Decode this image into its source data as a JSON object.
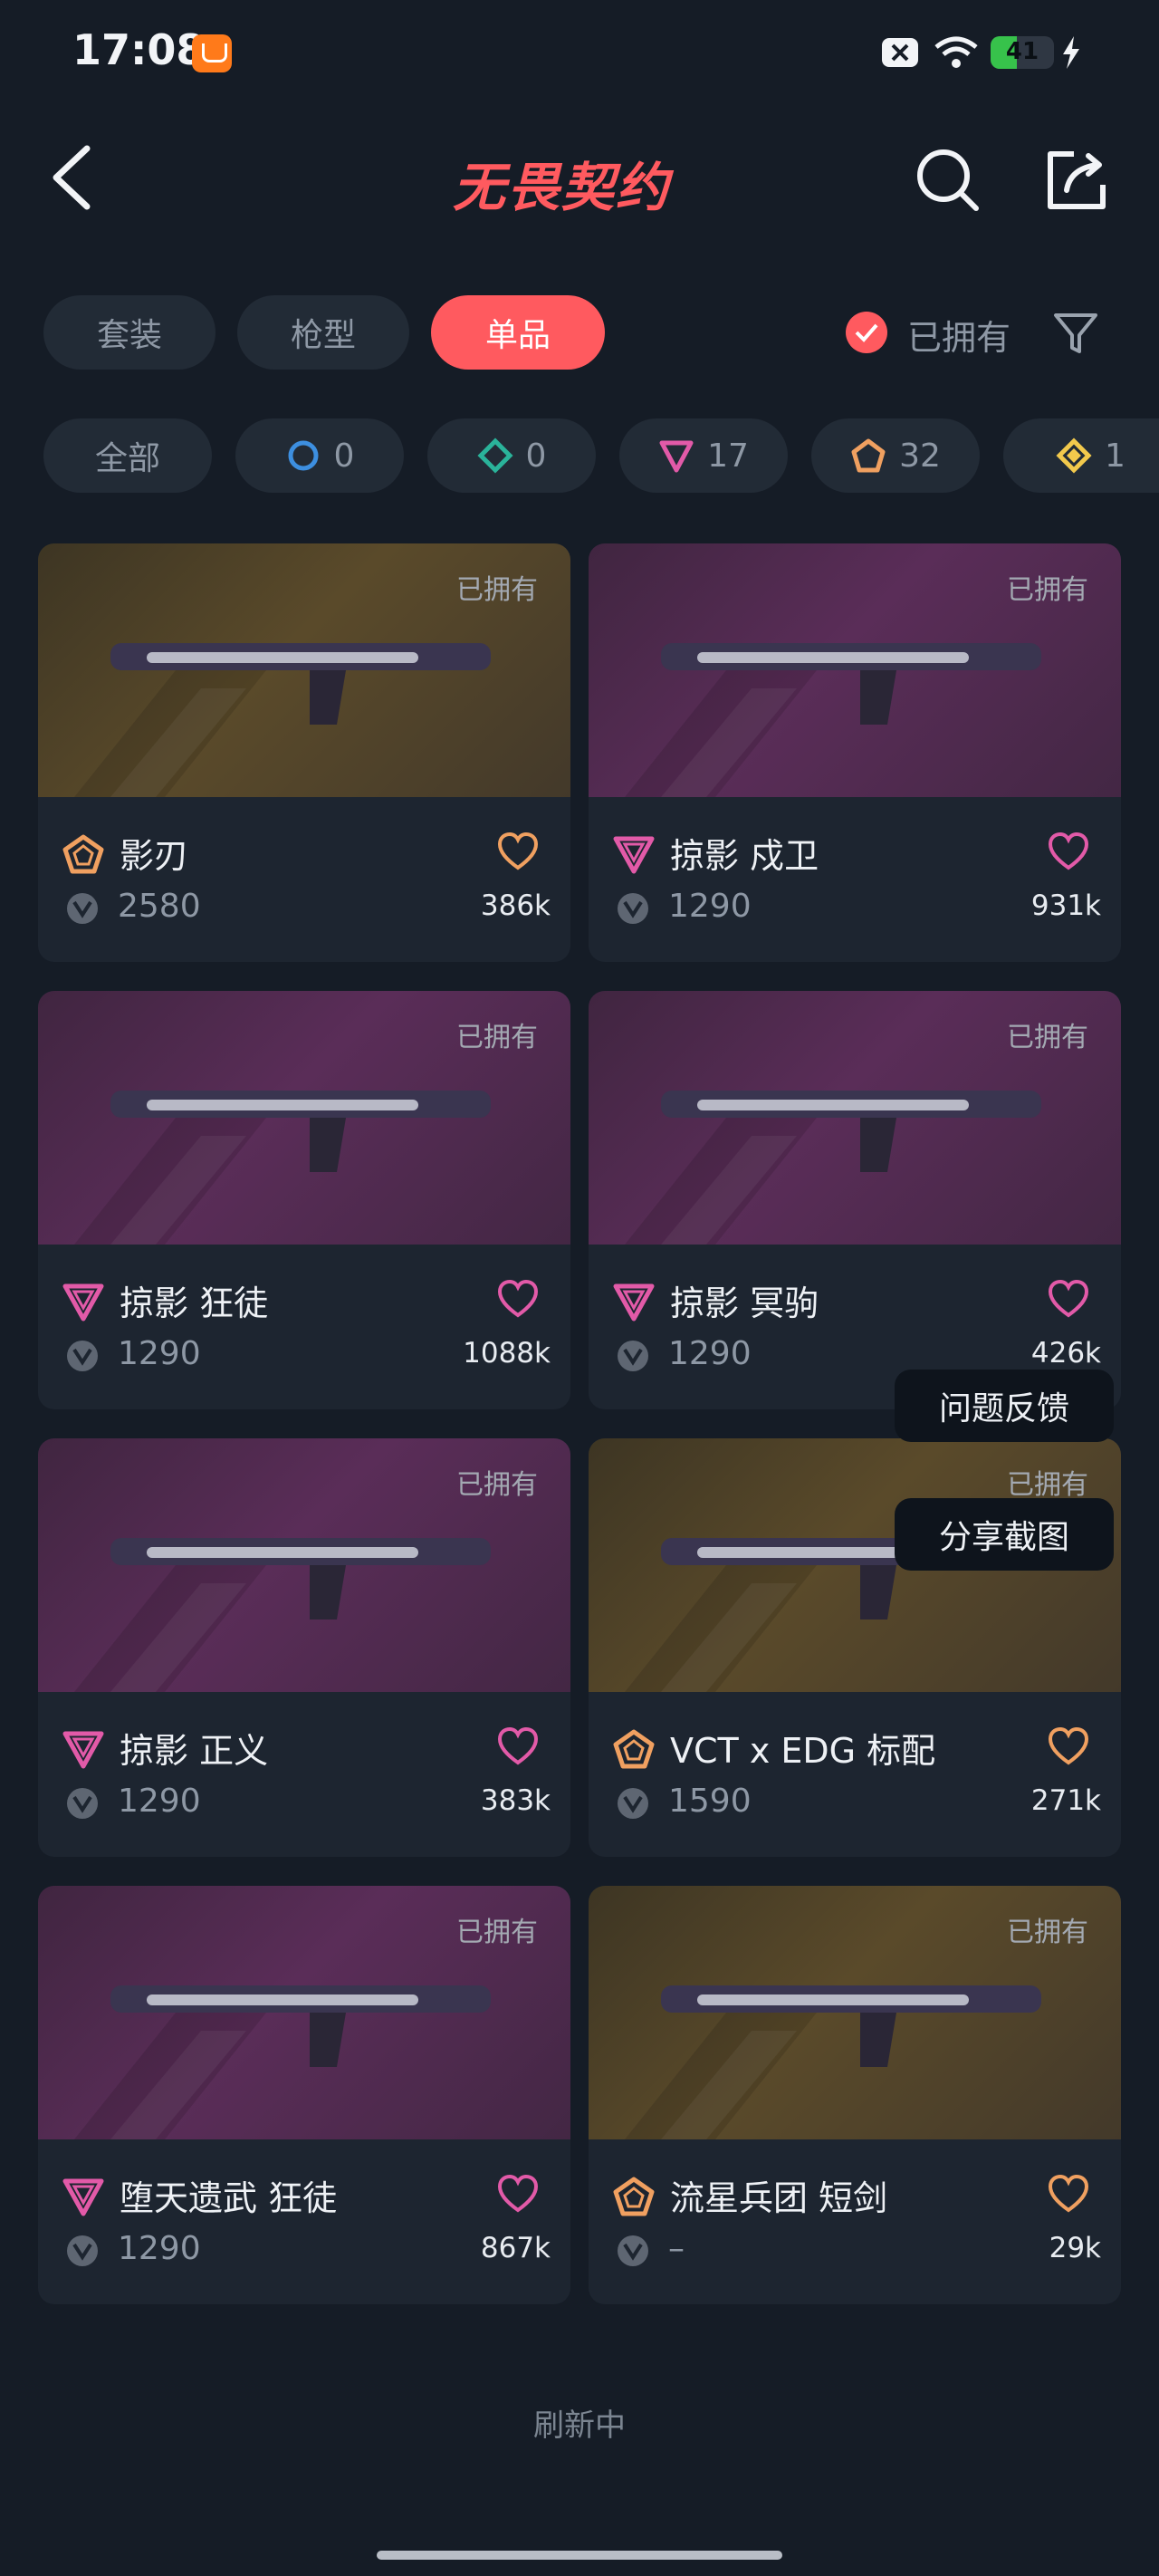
{
  "status_bar": {
    "time": "17:08",
    "battery": "41"
  },
  "header": {
    "title": "无畏契约"
  },
  "tabs": [
    {
      "label": "套装",
      "active": false
    },
    {
      "label": "枪型",
      "active": false
    },
    {
      "label": "单品",
      "active": true
    }
  ],
  "owned_filter": {
    "label": "已拥有",
    "checked": true
  },
  "rarity_chips": [
    {
      "label": "全部",
      "icon": "",
      "count": ""
    },
    {
      "label": "",
      "icon": "select-tier-icon",
      "count": "0"
    },
    {
      "label": "",
      "icon": "deluxe-tier-icon",
      "count": "0"
    },
    {
      "label": "",
      "icon": "premium-tier-icon",
      "count": "17"
    },
    {
      "label": "",
      "icon": "exclusive-tier-icon",
      "count": "32"
    },
    {
      "label": "",
      "icon": "ultra-tier-icon",
      "count": "1"
    }
  ],
  "colors": {
    "accent": "#ff5a5f",
    "exclusive": "#f0a060",
    "premium": "#e25aa8",
    "ultra": "#f2c94c"
  },
  "items": [
    {
      "owned": "已拥有",
      "name": "影刃",
      "rarity": "exclusive",
      "price": "2580",
      "likes": "386k",
      "bg": "gold"
    },
    {
      "owned": "已拥有",
      "name": "掠影 戍卫",
      "rarity": "premium",
      "price": "1290",
      "likes": "931k",
      "bg": "purple"
    },
    {
      "owned": "已拥有",
      "name": "掠影 狂徒",
      "rarity": "premium",
      "price": "1290",
      "likes": "1088k",
      "bg": "purple"
    },
    {
      "owned": "已拥有",
      "name": "掠影 冥驹",
      "rarity": "premium",
      "price": "1290",
      "likes": "426k",
      "bg": "purple"
    },
    {
      "owned": "已拥有",
      "name": "掠影 正义",
      "rarity": "premium",
      "price": "1290",
      "likes": "383k",
      "bg": "purple"
    },
    {
      "owned": "已拥有",
      "name": "VCT x EDG 标配",
      "rarity": "exclusive",
      "price": "1590",
      "likes": "271k",
      "bg": "gold"
    },
    {
      "owned": "已拥有",
      "name": "堕天遗武 狂徒",
      "rarity": "premium",
      "price": "1290",
      "likes": "867k",
      "bg": "purple"
    },
    {
      "owned": "已拥有",
      "name": "流星兵团 短剑",
      "rarity": "exclusive",
      "price": "–",
      "likes": "29k",
      "bg": "gold"
    }
  ],
  "floating": {
    "feedback": "问题反馈",
    "share": "分享截图"
  },
  "footer": {
    "refresh": "刷新中"
  }
}
